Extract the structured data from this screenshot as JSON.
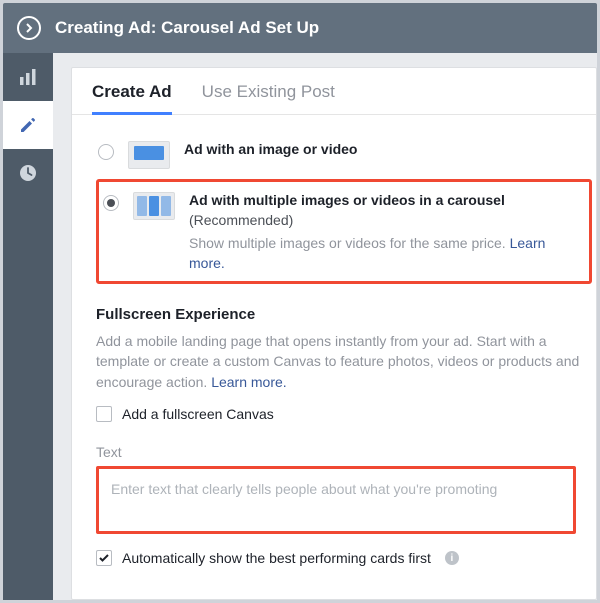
{
  "header": {
    "title": "Creating Ad: Carousel Ad Set Up"
  },
  "tabs": {
    "create": "Create Ad",
    "existing": "Use Existing Post"
  },
  "options": {
    "single": {
      "title": "Ad with an image or video"
    },
    "carousel": {
      "title": "Ad with multiple images or videos in a carousel",
      "recommended": "(Recommended)",
      "desc": "Show multiple images or videos for the same price. ",
      "learn": "Learn more."
    }
  },
  "fullscreen": {
    "title": "Fullscreen Experience",
    "desc": "Add a mobile landing page that opens instantly from your ad. Start with a template or create a custom Canvas to feature photos, videos or products and encourage action. ",
    "learn": "Learn more.",
    "checkbox": "Add a fullscreen Canvas"
  },
  "text": {
    "label": "Text",
    "placeholder": "Enter text that clearly tells people about what you're promoting"
  },
  "auto": {
    "label": "Automatically show the best performing cards first"
  }
}
